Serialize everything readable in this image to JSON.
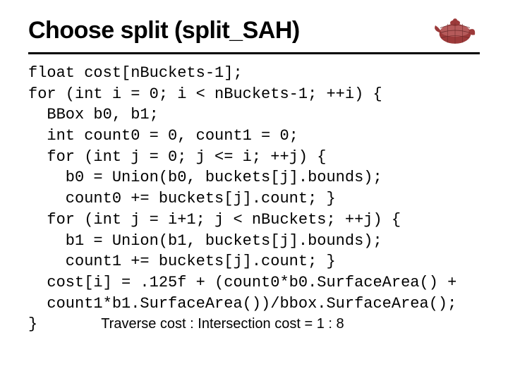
{
  "slide": {
    "title": "Choose split (split_SAH)"
  },
  "code": {
    "l1": "float cost[nBuckets-1];",
    "l2": "for (int i = 0; i < nBuckets-1; ++i) {",
    "l3": "  BBox b0, b1;",
    "l4": "  int count0 = 0, count1 = 0;",
    "l5": "  for (int j = 0; j <= i; ++j) {",
    "l6": "    b0 = Union(b0, buckets[j].bounds);",
    "l7": "    count0 += buckets[j].count; }",
    "l8": "  for (int j = i+1; j < nBuckets; ++j) {",
    "l9": "    b1 = Union(b1, buckets[j].bounds);",
    "l10": "    count1 += buckets[j].count; }",
    "l11": "  cost[i] = .125f + (count0*b0.SurfaceArea() +",
    "l12": "  count1*b1.SurfaceArea())/bbox.SurfaceArea();",
    "l13": "}"
  },
  "caption": "Traverse cost : Intersection cost = 1 : 8",
  "colors": {
    "teapot": "#9c3a3a"
  }
}
